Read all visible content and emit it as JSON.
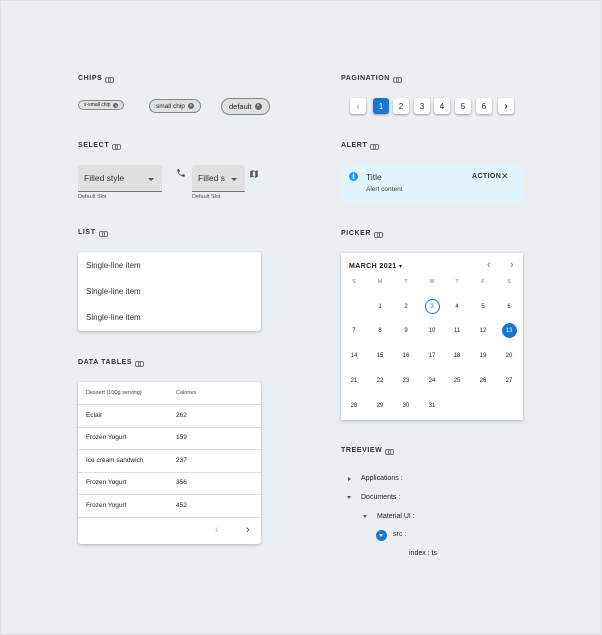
{
  "sections": {
    "chips": "CHIPS",
    "pagination": "PAGINATION",
    "select": "SELECT",
    "alert": "ALERT",
    "list": "LIST",
    "picker": "PICKER",
    "data_tables": "DATA TABLES",
    "treeview": "TREEVIEW"
  },
  "chips": [
    "x-small chip",
    "small chip",
    "default"
  ],
  "pagination": {
    "pages": [
      "1",
      "2",
      "3",
      "4",
      "5",
      "6"
    ],
    "active": "1",
    "prev": "‹",
    "next": "›"
  },
  "select": {
    "filled": {
      "value": "Filled style",
      "hint": "Default Slot"
    },
    "filled_icons": {
      "value": "Filled s",
      "hint": "Default Slot"
    }
  },
  "alert": {
    "title": "Title",
    "content": "Alert content",
    "action": "ACTION",
    "close": "✕",
    "icon": "info-icon"
  },
  "list": {
    "items": [
      "Single-line item",
      "Single-line item",
      "Single-line item"
    ]
  },
  "data_table": {
    "headers": [
      "Dessert (100g serving)",
      "Calories"
    ],
    "rows": [
      [
        "Eclair",
        "262"
      ],
      [
        "Frozen Yogurt",
        "159"
      ],
      [
        "Ice cream sandwich",
        "237"
      ],
      [
        "Frozen Yogurt",
        "356"
      ],
      [
        "Frozen Yogurt",
        "452"
      ]
    ],
    "prev": "‹",
    "next": "›"
  },
  "picker": {
    "month": "MARCH 2021",
    "weekdays": [
      "S",
      "M",
      "T",
      "W",
      "T",
      "F",
      "S"
    ],
    "weeks": [
      [
        "",
        "1",
        "2",
        "3",
        "4",
        "5",
        "6"
      ],
      [
        "7",
        "8",
        "9",
        "10",
        "11",
        "12",
        "13"
      ],
      [
        "14",
        "15",
        "16",
        "17",
        "18",
        "19",
        "20"
      ],
      [
        "21",
        "22",
        "23",
        "24",
        "25",
        "26",
        "27"
      ],
      [
        "28",
        "29",
        "30",
        "31",
        "",
        "",
        ""
      ]
    ],
    "today": "3",
    "selected": "13",
    "prev": "‹",
    "next": "›"
  },
  "treeview": {
    "applications": "Applications :",
    "documents": "Documents :",
    "material_ui": "Material UI :",
    "src": "src :",
    "index": "index : ts"
  },
  "colors": {
    "primary": "#1976d2",
    "alert_bg": "#e1f5fe",
    "page_bg": "#eceff1"
  }
}
